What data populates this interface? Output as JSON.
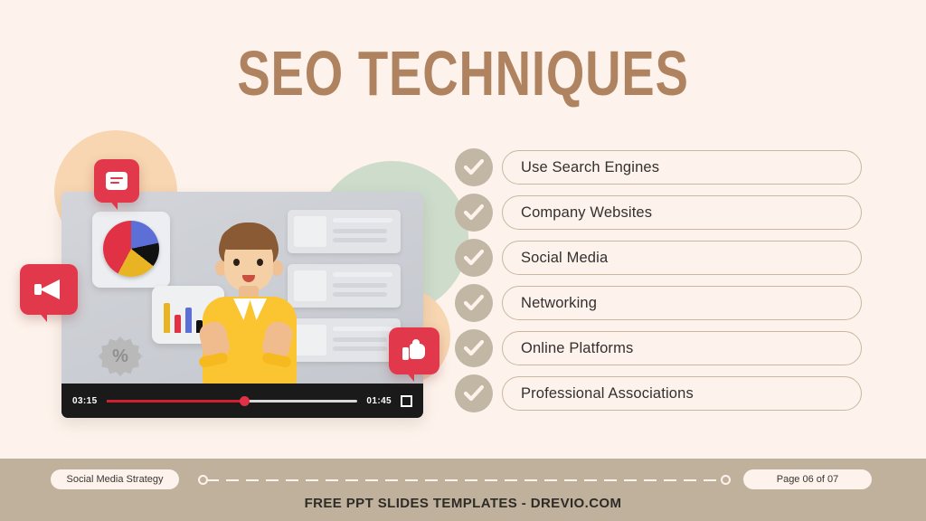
{
  "slide": {
    "title": "SEO TECHNIQUES",
    "background_color": "#FDF3EC",
    "title_color": "#B08360",
    "accent_color": "#C2B7A4",
    "footer_band_color": "#BFB19C"
  },
  "checklist": {
    "items": [
      {
        "label": "Use Search Engines",
        "icon": "check-icon"
      },
      {
        "label": "Company Websites",
        "icon": "check-icon"
      },
      {
        "label": "Social Media",
        "icon": "check-icon"
      },
      {
        "label": "Networking",
        "icon": "check-icon"
      },
      {
        "label": "Online Platforms",
        "icon": "check-icon"
      },
      {
        "label": "Professional Associations",
        "icon": "check-icon"
      }
    ]
  },
  "illustration": {
    "alt": "3d-presenter-video-illustration",
    "video_player": {
      "elapsed_time": "03:15",
      "remaining_time": "01:45",
      "progress_percent": 55,
      "fullscreen_icon": "fullscreen-icon",
      "progress_color": "#D21F30"
    },
    "bubbles": [
      {
        "icon": "comment-icon",
        "color": "#E2384B"
      },
      {
        "icon": "megaphone-icon",
        "color": "#E2384B"
      },
      {
        "icon": "thumbs-up-icon",
        "color": "#E2384B"
      }
    ],
    "percent_badge": "%",
    "pie_chart_colors": [
      "#E03244",
      "#5B6FD6",
      "#111111",
      "#E8B424"
    ],
    "bar_chart_colors": [
      "#E8B424",
      "#E03244",
      "#5B6FD6",
      "#111111"
    ]
  },
  "footer": {
    "tag_label": "Social Media Strategy",
    "page_label": "Page 06 of 07",
    "credit": "FREE PPT SLIDES TEMPLATES - DREVIO.COM"
  }
}
